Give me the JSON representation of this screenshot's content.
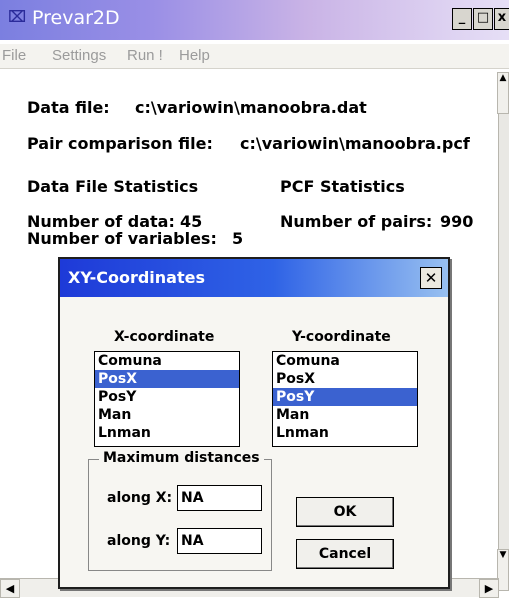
{
  "window": {
    "title": "Prevar2D",
    "icon": "sigma-icon",
    "buttons": {
      "minimize": "_",
      "maximize": "□",
      "close": "x"
    }
  },
  "menu": [
    "File",
    "Settings",
    "Run !",
    "Help"
  ],
  "main": {
    "data_file_label": "Data file:",
    "data_file_value": "c:\\variowin\\manoobra.dat",
    "pair_file_label": "Pair comparison file:",
    "pair_file_value": "c:\\variowin\\manoobra.pcf",
    "data_stats_title": "Data File Statistics",
    "pcf_stats_title": "PCF Statistics",
    "num_data_label": "Number of data:",
    "num_data_value": "45",
    "num_vars_label": "Number of variables:",
    "num_vars_value": "5",
    "num_pairs_label": "Number of pairs:",
    "num_pairs_value": "990"
  },
  "dialog": {
    "title": "XY-Coordinates",
    "x_header": "X-coordinate",
    "y_header": "Y-coordinate",
    "x_items": [
      "Comuna",
      "PosX",
      "PosY",
      "Man",
      "Lnman"
    ],
    "x_selected_index": 1,
    "y_items": [
      "Comuna",
      "PosX",
      "PosY",
      "Man",
      "Lnman"
    ],
    "y_selected_index": 2,
    "group_title": "Maximum distances",
    "along_x_label": "along X:",
    "along_x_value": "NA",
    "along_y_label": "along Y:",
    "along_y_value": "NA",
    "ok_label": "OK",
    "cancel_label": "Cancel"
  }
}
